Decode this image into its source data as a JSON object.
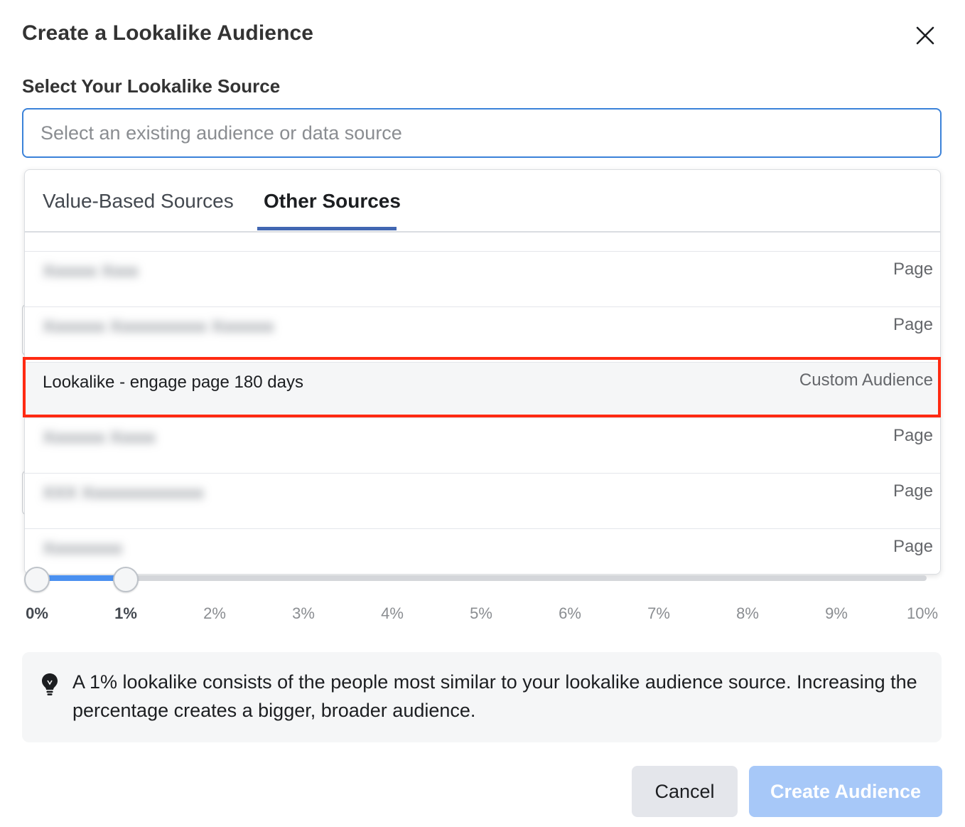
{
  "dialog": {
    "title": "Create a Lookalike Audience",
    "section_label": "Select Your Lookalike Source",
    "search_placeholder": "Select an existing audience or data source"
  },
  "dropdown": {
    "tabs": [
      {
        "label": "Value-Based Sources",
        "active": false
      },
      {
        "label": "Other Sources",
        "active": true
      }
    ],
    "rows": [
      {
        "name": "",
        "type": "Page",
        "blurred": true
      },
      {
        "name": "",
        "type": "Page",
        "blurred": true
      },
      {
        "name": "Lookalike - engage page 180 days",
        "type": "Custom Audience",
        "blurred": false,
        "highlighted": true
      },
      {
        "name": "",
        "type": "Page",
        "blurred": true
      },
      {
        "name": "",
        "type": "Page",
        "blurred": true
      },
      {
        "name": "",
        "type": "Page",
        "blurred": true
      }
    ]
  },
  "slider": {
    "ticks": [
      "0%",
      "1%",
      "2%",
      "3%",
      "4%",
      "5%",
      "6%",
      "7%",
      "8%",
      "9%",
      "10%"
    ],
    "range_start_percent": 0,
    "range_end_percent": 1,
    "accent": "#4a90f0"
  },
  "info": {
    "icon": "lightbulb-icon",
    "text": "A 1% lookalike consists of the people most similar to your lookalike audience source. Increasing the percentage creates a bigger, broader audience."
  },
  "buttons": {
    "cancel": "Cancel",
    "create": "Create Audience"
  },
  "colors": {
    "highlight": "#ff2a12",
    "tab_active": "#4267b2",
    "create_button": "#a7c8f8"
  }
}
